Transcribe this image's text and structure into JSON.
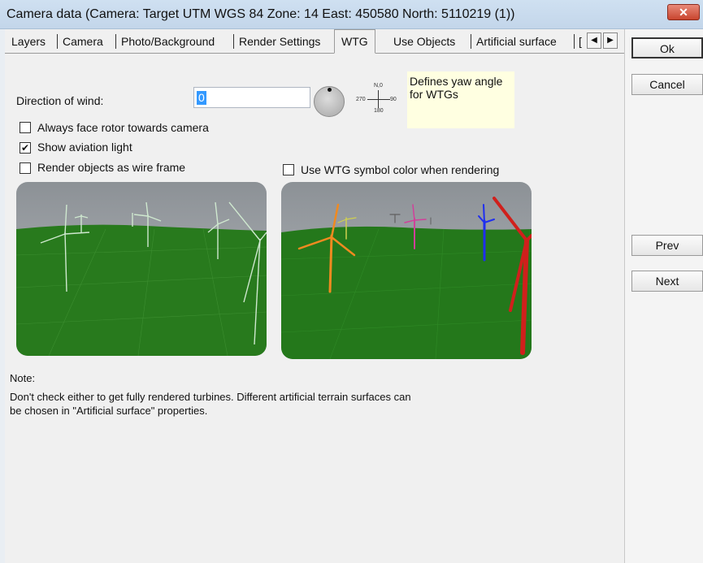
{
  "window": {
    "title": "Camera data  (Camera:  Target UTM WGS 84 Zone: 14  East: 450580  North: 5110219 (1))",
    "close_label": "✕"
  },
  "tabs": [
    "Layers",
    "Camera",
    "Photo/Background",
    "Render Settings",
    "WTG",
    "Use Objects",
    "Artificial surface",
    "["
  ],
  "wind": {
    "label": "Direction of wind:",
    "value": "0",
    "tooltip": "Defines yaw angle for WTGs",
    "compass_n": "N,0",
    "compass_s": "180",
    "compass_w": "270",
    "compass_e": "90"
  },
  "options": {
    "face_rotor": {
      "label": "Always face rotor towards camera",
      "checked": false
    },
    "aviation_light": {
      "label": "Show aviation light",
      "checked": true
    },
    "wire_frame": {
      "label": "Render objects as wire frame",
      "checked": false
    },
    "symbol_color": {
      "label": "Use WTG symbol color when rendering",
      "checked": false
    }
  },
  "note": {
    "heading": "Note:",
    "line1": "Don't check either to get fully rendered turbines. Different artificial terrain surfaces can",
    "line2": "be chosen in \"Artificial surface\" properties."
  },
  "buttons": {
    "ok": "Ok",
    "cancel": "Cancel",
    "prev": "Prev",
    "next": "Next"
  },
  "colors": {
    "ground": "#2a7a1e",
    "sky": "#9ea3a8",
    "tooltip": "#ffffe1",
    "turbine_orange": "#f08a20",
    "turbine_blue": "#1f2ef0",
    "turbine_red": "#d0201c",
    "turbine_pink": "#d0409a"
  }
}
